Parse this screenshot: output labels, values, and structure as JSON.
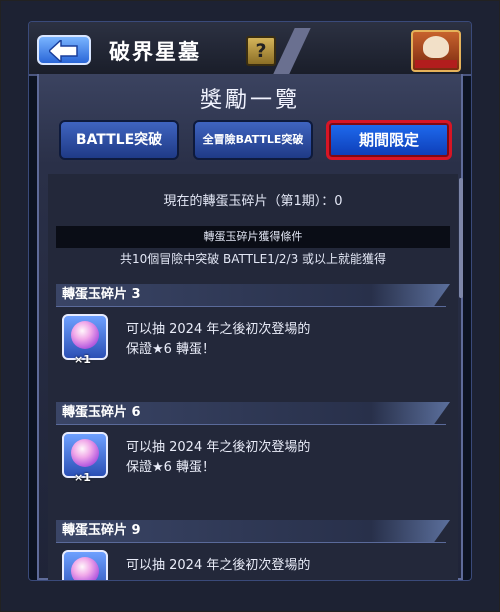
{
  "header": {
    "title": "破界星墓",
    "help_label": "?"
  },
  "panel": {
    "title": "獎勵一覽",
    "tabs": [
      {
        "label": "BATTLE突破"
      },
      {
        "label": "全冒險BATTLE突破"
      },
      {
        "label": "期間限定"
      }
    ],
    "selected_tab": "期間限定"
  },
  "content": {
    "status": "現在的轉蛋玉碎片（第1期）：0",
    "condition_title": "轉蛋玉碎片獲得條件",
    "condition_text": "共10個冒險中突破 BATTLE1/2/3 或以上就能獲得",
    "rewards": [
      {
        "title": "轉蛋玉碎片 3",
        "qty": "×1",
        "line1": "可以抽 2024 年之後初次登場的",
        "line2": "保證★6 轉蛋！"
      },
      {
        "title": "轉蛋玉碎片 6",
        "qty": "×1",
        "line1": "可以抽 2024 年之後初次登場的",
        "line2": "保證★6 轉蛋！"
      },
      {
        "title": "轉蛋玉碎片 9",
        "qty": "",
        "line1": "可以抽 2024 年之後初次登場的",
        "line2": ""
      }
    ]
  },
  "colors": {
    "selected_tab_border": "#d81525",
    "tab_fill": "#2f56b0"
  }
}
